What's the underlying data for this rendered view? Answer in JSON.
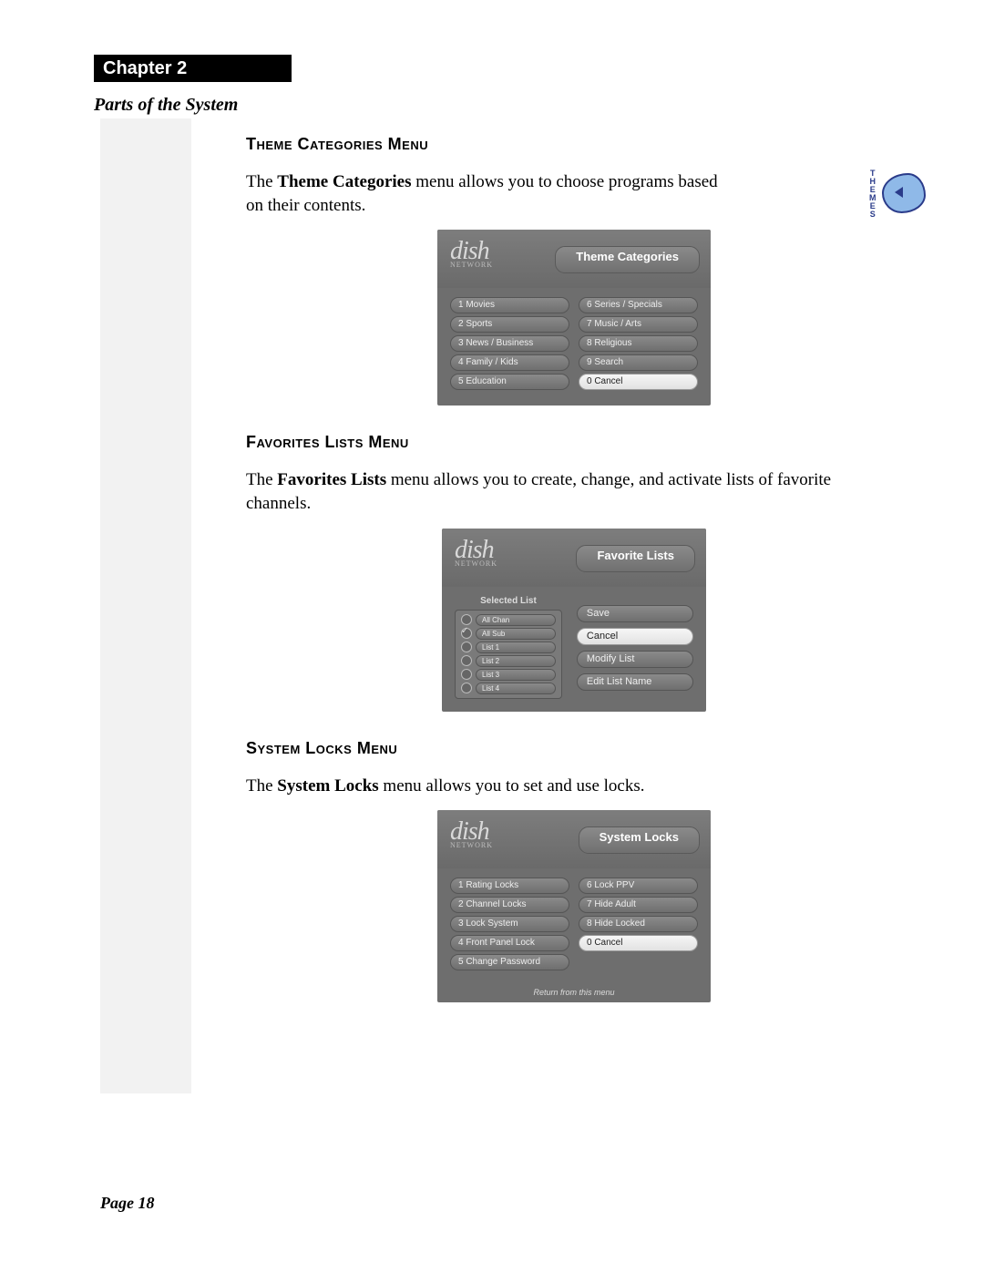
{
  "chapter": "Chapter 2",
  "section_title": "Parts of the System",
  "page_label": "Page 18",
  "themes_icon_label": "THEMES",
  "sections": {
    "theme": {
      "heading": "Theme Categories Menu",
      "para_pre": "The ",
      "para_bold": "Theme Categories",
      "para_post": " menu allows you to choose programs based on their contents.",
      "screenshot": {
        "logo": "dish",
        "logo_sub": "NETWORK",
        "title": "Theme Categories",
        "left": [
          "1 Movies",
          "2 Sports",
          "3 News / Business",
          "4 Family / Kids",
          "5 Education"
        ],
        "right": [
          "6 Series / Specials",
          "7 Music / Arts",
          "8 Religious",
          "9 Search",
          "0 Cancel"
        ],
        "highlight_index": 9
      }
    },
    "favorites": {
      "heading": "Favorites Lists Menu",
      "para_pre": "The ",
      "para_bold": "Favorites Lists",
      "para_post": " menu allows you to create, change, and activate lists of favorite channels.",
      "screenshot": {
        "logo": "dish",
        "logo_sub": "NETWORK",
        "title": "Favorite Lists",
        "selected_header": "Selected List",
        "lists": [
          {
            "label": "All Chan",
            "checked": false
          },
          {
            "label": "All Sub",
            "checked": true
          },
          {
            "label": "List 1",
            "checked": false
          },
          {
            "label": "List 2",
            "checked": false
          },
          {
            "label": "List 3",
            "checked": false
          },
          {
            "label": "List 4",
            "checked": false
          }
        ],
        "buttons": [
          {
            "label": "Save",
            "white": false
          },
          {
            "label": "Cancel",
            "white": true
          },
          {
            "label": "Modify List",
            "white": false
          },
          {
            "label": "Edit List Name",
            "white": false
          }
        ]
      }
    },
    "locks": {
      "heading": "System Locks Menu",
      "para_pre": "The ",
      "para_bold": "System Locks",
      "para_post": " menu allows you to set and use locks.",
      "screenshot": {
        "logo": "dish",
        "logo_sub": "NETWORK",
        "title": "System Locks",
        "left": [
          "1 Rating Locks",
          "2 Channel Locks",
          "3 Lock System",
          "4 Front Panel Lock",
          "5 Change Password"
        ],
        "right": [
          "6 Lock PPV",
          "7 Hide Adult",
          "8 Hide Locked",
          "0 Cancel"
        ],
        "right_highlight_index": 3,
        "return_text": "Return from this menu"
      }
    }
  }
}
